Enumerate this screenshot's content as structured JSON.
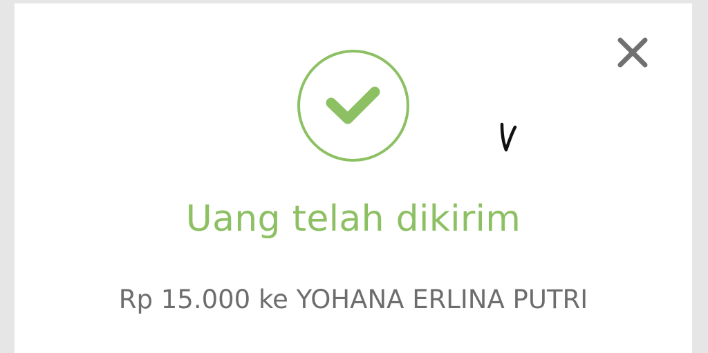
{
  "dialog": {
    "close_icon": "close-icon",
    "status_icon": "check-circle-icon",
    "title": "Uang telah dikirim",
    "detail": "Rp 15.000 ke YOHANA ERLINA PUTRI",
    "handwritten_mark": "v"
  },
  "colors": {
    "success_green": "#8cc063",
    "text_gray": "#6d6d6d",
    "icon_gray": "#707070",
    "background": "#e6e6e6",
    "card": "#ffffff"
  }
}
